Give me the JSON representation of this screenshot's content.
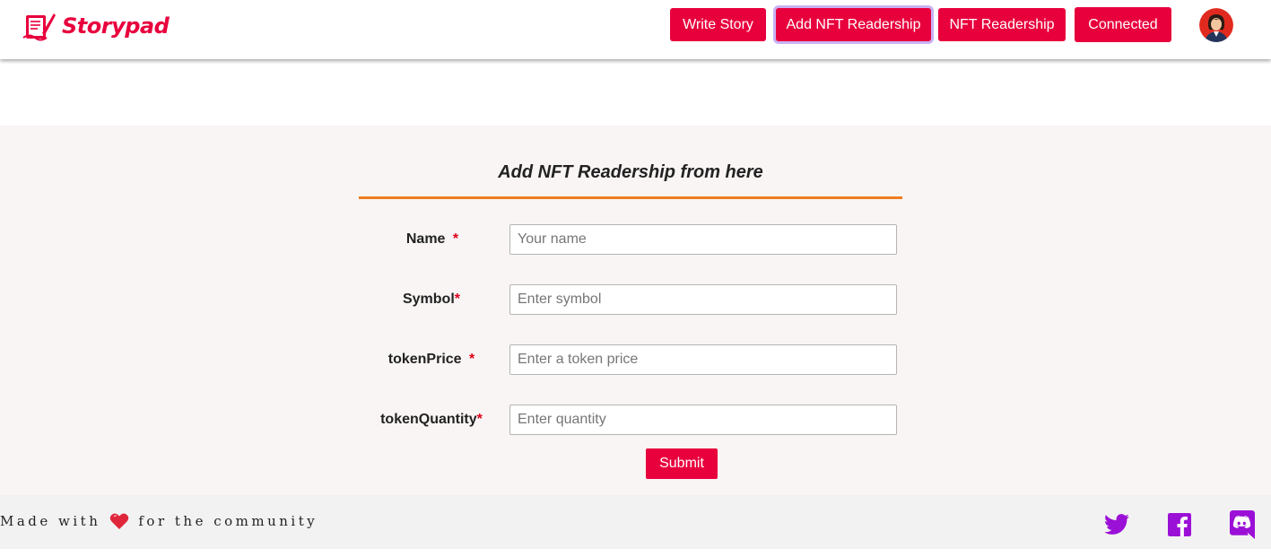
{
  "brand": {
    "name": "Storypad",
    "color": "#e8003d"
  },
  "nav": {
    "write_story": "Write Story",
    "add_nft": "Add NFT Readership",
    "nft_readership": "NFT Readership",
    "connected": "Connected"
  },
  "form": {
    "title": "Add NFT Readership from here",
    "fields": [
      {
        "label": "Name",
        "required_mark": "*",
        "placeholder": "Your name"
      },
      {
        "label": "Symbol",
        "required_mark": "*",
        "placeholder": "Enter symbol"
      },
      {
        "label": "tokenPrice",
        "required_mark": "*",
        "placeholder": "Enter a token price"
      },
      {
        "label": "tokenQuantity",
        "required_mark": "*",
        "placeholder": "Enter quantity"
      }
    ],
    "submit_label": "Submit"
  },
  "footer": {
    "text_before": "Made with",
    "text_after": "for the community",
    "social_icons": [
      "twitter-icon",
      "facebook-icon",
      "discord-icon"
    ],
    "social_color": "#9b10d6"
  }
}
